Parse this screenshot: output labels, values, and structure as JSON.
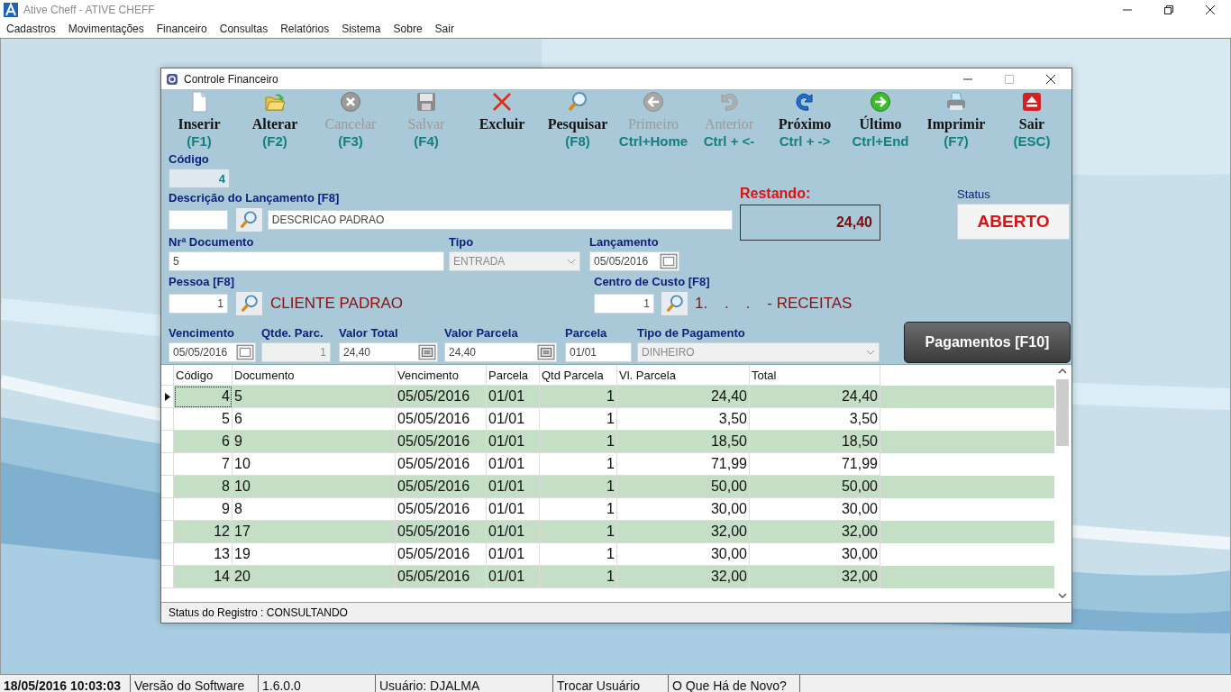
{
  "app": {
    "title": "Ative Cheff - ATIVE CHEFF"
  },
  "menu": [
    "Cadastros",
    "Movimentações",
    "Financeiro",
    "Consultas",
    "Relatórios",
    "Sistema",
    "Sobre",
    "Sair"
  ],
  "window": {
    "title": "Controle Financeiro"
  },
  "toolbar": [
    {
      "label": "Inserir",
      "shortcut": "(F1)",
      "kind": "new",
      "disabled": false
    },
    {
      "label": "Alterar",
      "shortcut": "(F2)",
      "kind": "edit",
      "disabled": false
    },
    {
      "label": "Cancelar",
      "shortcut": "(F3)",
      "kind": "cancel",
      "disabled": true
    },
    {
      "label": "Salvar",
      "shortcut": "(F4)",
      "kind": "save",
      "disabled": true
    },
    {
      "label": "Excluir",
      "kind": "delete",
      "disabled": false
    },
    {
      "label": "Pesquisar",
      "shortcut": "(F8)",
      "kind": "search",
      "disabled": false
    },
    {
      "label": "Primeiro",
      "shortcut": "Ctrl+Home",
      "kind": "first",
      "disabled": true
    },
    {
      "label": "Anterior",
      "shortcut": "Ctrl + <-",
      "kind": "previous",
      "disabled": true
    },
    {
      "label": "Próximo",
      "shortcut": "Ctrl + ->",
      "kind": "next",
      "disabled": false
    },
    {
      "label": "Último",
      "shortcut": "Ctrl+End",
      "kind": "last",
      "disabled": false
    },
    {
      "label": "Imprimir",
      "shortcut": "(F7)",
      "kind": "print",
      "disabled": false
    },
    {
      "label": "Sair",
      "shortcut": "(ESC)",
      "kind": "exit",
      "disabled": false
    }
  ],
  "form": {
    "codigo": {
      "label": "Código",
      "value": "4"
    },
    "descricao": {
      "label": "Descrição do Lançamento [F8]",
      "text": "DESCRICAO PADRAO"
    },
    "restando": {
      "label": "Restando:",
      "value": "24,40"
    },
    "status": {
      "label": "Status",
      "value": "ABERTO"
    },
    "documento": {
      "label": "Nrª Documento",
      "value": "5"
    },
    "tipo": {
      "label": "Tipo",
      "value": "ENTRADA",
      "disabled": true
    },
    "lancamento": {
      "label": "Lançamento",
      "value": "05/05/2016"
    },
    "pessoa": {
      "label": "Pessoa [F8]",
      "code": "1",
      "name": "CLIENTE PADRAO"
    },
    "centro_custo": {
      "label": "Centro de Custo [F8]",
      "code": "1",
      "name": "1.    .    .    - RECEITAS"
    },
    "vencimento": {
      "label": "Vencimento",
      "value": "05/05/2016"
    },
    "qtde_parc": {
      "label": "Qtde. Parc.",
      "value": "1",
      "disabled": true
    },
    "valor_total": {
      "label": "Valor Total",
      "value": "24,40"
    },
    "valor_parcela": {
      "label": "Valor Parcela",
      "value": "24,40"
    },
    "parcela": {
      "label": "Parcela",
      "value": "01/01"
    },
    "tipo_pagamento": {
      "label": "Tipo de Pagamento",
      "value": "DINHEIRO",
      "disabled": true
    }
  },
  "pagamentos_button": "Pagamentos [F10]",
  "table": {
    "columns": [
      "Código",
      "Documento",
      "Vencimento",
      "Parcela",
      "Qtd Parcela",
      "Vl. Parcela",
      "Total"
    ],
    "rows": [
      {
        "cells": [
          "4",
          "5",
          "05/05/2016",
          "01/01",
          "1",
          "24,40",
          "24,40"
        ],
        "selected": true
      },
      {
        "cells": [
          "5",
          "6",
          "05/05/2016",
          "01/01",
          "1",
          "3,50",
          "3,50"
        ],
        "selected": false
      },
      {
        "cells": [
          "6",
          "9",
          "05/05/2016",
          "01/01",
          "1",
          "18,50",
          "18,50"
        ],
        "selected": false
      },
      {
        "cells": [
          "7",
          "10",
          "05/05/2016",
          "01/01",
          "1",
          "71,99",
          "71,99"
        ],
        "selected": false
      },
      {
        "cells": [
          "8",
          "10",
          "05/05/2016",
          "01/01",
          "1",
          "50,00",
          "50,00"
        ],
        "selected": false
      },
      {
        "cells": [
          "9",
          "8",
          "05/05/2016",
          "01/01",
          "1",
          "30,00",
          "30,00"
        ],
        "selected": false
      },
      {
        "cells": [
          "12",
          "17",
          "05/05/2016",
          "01/01",
          "1",
          "32,00",
          "32,00"
        ],
        "selected": false
      },
      {
        "cells": [
          "13",
          "19",
          "05/05/2016",
          "01/01",
          "1",
          "30,00",
          "30,00"
        ],
        "selected": false
      },
      {
        "cells": [
          "14",
          "20",
          "05/05/2016",
          "01/01",
          "1",
          "32,00",
          "32,00"
        ],
        "selected": false
      }
    ]
  },
  "status_bar": "Status do Registro : CONSULTANDO",
  "footer": [
    {
      "text": "18/05/2016 10:03:03"
    },
    {
      "text": "Versão do Software"
    },
    {
      "text": "1.6.0.0"
    },
    {
      "text": "Usuário: DJALMA"
    },
    {
      "text": "Trocar Usuário"
    },
    {
      "text": "O Que Há de Novo?"
    }
  ]
}
